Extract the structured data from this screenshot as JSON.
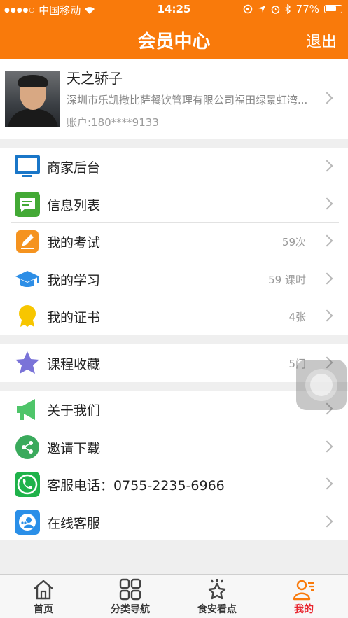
{
  "status_bar": {
    "signal_dots": "●●●●○",
    "carrier": "中国移动",
    "time": "14:25",
    "battery": "77%",
    "battery_level": 0.77
  },
  "nav": {
    "title": "会员中心",
    "logout": "退出"
  },
  "profile": {
    "name": "天之骄子",
    "company": "深圳市乐凯撒比萨餐饮管理有限公司福田绿景虹湾...",
    "account": "账户:180****9133"
  },
  "menu_group1": [
    {
      "label": "商家后台",
      "value": "",
      "icon": "monitor-icon"
    },
    {
      "label": "信息列表",
      "value": "",
      "icon": "message-icon"
    },
    {
      "label": "我的考试",
      "value": "59次",
      "icon": "exam-pencil-icon"
    },
    {
      "label": "我的学习",
      "value": "59 课时",
      "icon": "graduation-cap-icon"
    },
    {
      "label": "我的证书",
      "value": "4张",
      "icon": "certificate-medal-icon"
    }
  ],
  "menu_group2": [
    {
      "label": "课程收藏",
      "value": "5门",
      "icon": "star-icon"
    }
  ],
  "menu_group3": [
    {
      "label": "关于我们",
      "value": "",
      "icon": "megaphone-icon"
    },
    {
      "label": "邀请下载",
      "value": "",
      "icon": "share-icon"
    },
    {
      "label": "客服电话：0755-2235-6966",
      "value": "",
      "icon": "phone-icon"
    },
    {
      "label": "在线客服",
      "value": "",
      "icon": "online-service-icon"
    }
  ],
  "tabs": [
    {
      "label": "首页",
      "icon": "home-icon",
      "active": false
    },
    {
      "label": "分类导航",
      "icon": "grid-icon",
      "active": false
    },
    {
      "label": "食安看点",
      "icon": "star-badge-icon",
      "active": false
    },
    {
      "label": "我的",
      "icon": "user-icon",
      "active": true
    }
  ],
  "colors": {
    "brand": "#f97a0b",
    "active_tab": "#e8262f"
  }
}
